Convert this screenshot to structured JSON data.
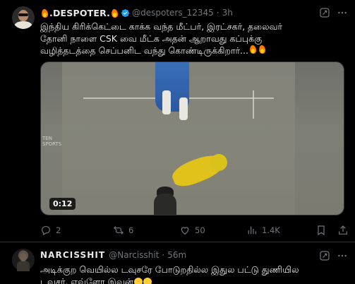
{
  "tweet": {
    "display_name": ".DESPOTER.",
    "handle": "@despoters_12345",
    "separator": "·",
    "time": "3h",
    "text_lines": [
      "இந்திய கிரிக்கெட்டை காக்க வந்த மீட்பர், இரட்சகர், தலைவர்",
      "தோனி நாளை CSK வை மீட்க அதன் ஆறாவது கப்புக்கு",
      "வழித்தடத்தை செப்பனிட வந்து கொண்டிருக்கிறார்..."
    ],
    "media": {
      "duration": "0:12",
      "watermark": "TEN SPORTS"
    },
    "actions": {
      "replies": "2",
      "reposts": "6",
      "likes": "50",
      "views": "1.4K"
    }
  },
  "reply": {
    "display_name": "NARCISSHIT",
    "handle": "@Narcisshit",
    "separator": "·",
    "time": "56m",
    "text_lines": [
      "அடிக்குற வெயில்ல டவுசரே போடுறதில்ல இதுல பட்டு துணியில",
      "டவுசர், எவ்ளோ இவன்"
    ]
  },
  "colors": {
    "background": "#000000",
    "text": "#e7e9ea",
    "muted": "#71767b",
    "verified": "#1d9bf0",
    "divider": "#2f3336"
  },
  "icons": [
    "fire-icon",
    "verified-badge-icon",
    "grok-icon",
    "more-icon",
    "reply-icon",
    "repost-icon",
    "like-icon",
    "views-icon",
    "bookmark-icon",
    "share-icon"
  ]
}
